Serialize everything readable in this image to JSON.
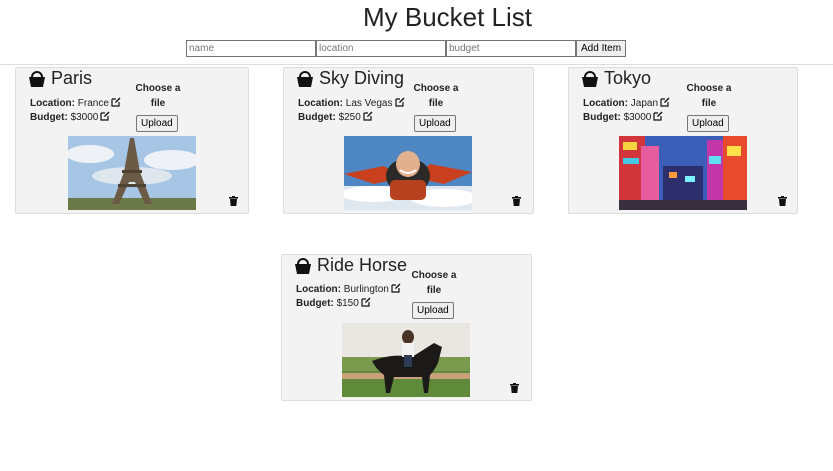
{
  "page": {
    "title": "My Bucket List"
  },
  "form": {
    "name_placeholder": "name",
    "location_placeholder": "location",
    "budget_placeholder": "budget",
    "add_label": "Add Item"
  },
  "labels": {
    "location": "Location:",
    "budget": "Budget:",
    "choose_file": "Choose a file",
    "upload": "Upload"
  },
  "items": [
    {
      "name": "Paris",
      "location": "France",
      "budget": "$3000",
      "photo": "eiffel-tower"
    },
    {
      "name": "Sky Diving",
      "location": "Las Vegas",
      "budget": "$250",
      "photo": "skydiver"
    },
    {
      "name": "Tokyo",
      "location": "Japan",
      "budget": "$3000",
      "photo": "tokyo-street"
    },
    {
      "name": "Ride Horse",
      "location": "Burlington",
      "budget": "$150",
      "photo": "horse-rider"
    }
  ]
}
